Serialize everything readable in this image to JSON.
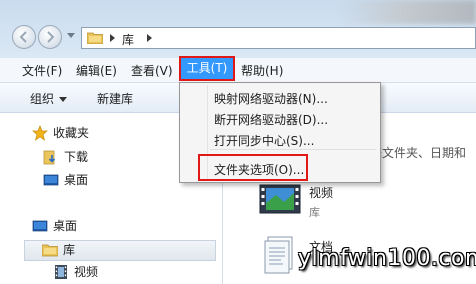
{
  "address": {
    "crumb": "库"
  },
  "menubar": {
    "file": "文件(F)",
    "edit": "编辑(E)",
    "view": "查看(V)",
    "tools": "工具(T)",
    "help": "帮助(H)"
  },
  "toolbar": {
    "organize": "组织",
    "new_library": "新建库"
  },
  "nav": {
    "favorites": "收藏夹",
    "downloads": "下载",
    "desktop_fav": "桌面",
    "desktop": "桌面",
    "libraries": "库",
    "videos": "视频"
  },
  "content": {
    "hint": "据文件夹、日期和",
    "video_lib": {
      "name": "视频",
      "sub": "库"
    },
    "doc_lib": {
      "name": "文档"
    }
  },
  "tools_menu": {
    "items": [
      "映射网络驱动器(N)...",
      "断开网络驱动器(D)...",
      "打开同步中心(S)...",
      "文件夹选项(O)..."
    ]
  },
  "watermark": "ylmfwin100.com",
  "colors": {
    "highlight_border": "#e01818",
    "menu_selected": "#3399ff"
  }
}
